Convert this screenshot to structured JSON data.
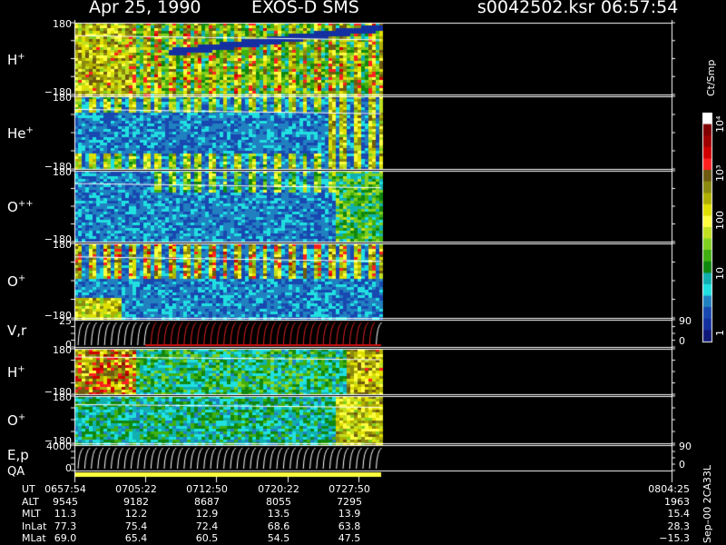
{
  "header": {
    "date": "Apr 25, 1990",
    "instrument": "EXOS-D SMS",
    "file": "s0042502.ksr",
    "time": "06:57:54"
  },
  "colorbar": {
    "title": "Ct/Smp",
    "labels": [
      "10⁴",
      "10³",
      "100",
      "10",
      "1"
    ],
    "colors": [
      "#ffffff",
      "#800000",
      "#a00000",
      "#d00000",
      "#ff2020",
      "#6e5a10",
      "#8a8a10",
      "#b0b000",
      "#e0e000",
      "#ffff40",
      "#c0e020",
      "#80d020",
      "#40b010",
      "#108810",
      "#10b0b0",
      "#20e0e0",
      "#2080c0",
      "#1848b0",
      "#1430a0",
      "#101878"
    ]
  },
  "chart_data": {
    "type": "heatmap",
    "time_axis": {
      "ticks": [
        "0657:54",
        "0705:22",
        "0712:50",
        "0720:22",
        "0727:50"
      ],
      "end": "0804:25"
    },
    "panels": [
      {
        "name": "H+",
        "label": "H",
        "sup": "+",
        "ytop": "180",
        "ybot": "−180"
      },
      {
        "name": "He+",
        "label": "He",
        "sup": "+",
        "ytop": "180",
        "ybot": "−180"
      },
      {
        "name": "O++",
        "label": "O",
        "sup": "++",
        "ytop": "180",
        "ybot": "−180"
      },
      {
        "name": "O+",
        "label": "O",
        "sup": "+",
        "ytop": "180",
        "ybot": "−180"
      },
      {
        "name": "V,r",
        "label": "V,r",
        "sup": "",
        "ytop": "25",
        "ybot": "0",
        "rtop": "90",
        "rbot": "0"
      },
      {
        "name": "H+ (2)",
        "label": "H",
        "sup": "+",
        "ytop": "180",
        "ybot": "−180"
      },
      {
        "name": "O+ (2)",
        "label": "O",
        "sup": "+",
        "ytop": "180",
        "ybot": "−180"
      },
      {
        "name": "E,p",
        "label": "E,p",
        "sup": "",
        "ytop": "4000",
        "ybot": "0",
        "rtop": "90",
        "rbot": "0"
      }
    ],
    "qa_label": "QA",
    "ephemeris": {
      "rows": [
        {
          "name": "UT",
          "values": [
            "0657:54",
            "0705:22",
            "0712:50",
            "0720:22",
            "0727:50"
          ],
          "end": "0804:25"
        },
        {
          "name": "ALT",
          "values": [
            "9545",
            "9182",
            "8687",
            "8055",
            "7295"
          ],
          "end": "1963"
        },
        {
          "name": "MLT",
          "values": [
            "11.3",
            "12.2",
            "12.9",
            "13.5",
            "13.9"
          ],
          "end": "15.4"
        },
        {
          "name": "InLat",
          "values": [
            "77.3",
            "75.4",
            "72.4",
            "68.6",
            "63.8"
          ],
          "end": "28.3"
        },
        {
          "name": "MLat",
          "values": [
            "69.0",
            "65.4",
            "60.5",
            "54.5",
            "47.5"
          ],
          "end": "−15.3"
        }
      ]
    },
    "footer_note": "Sep–00 2CA33L"
  }
}
